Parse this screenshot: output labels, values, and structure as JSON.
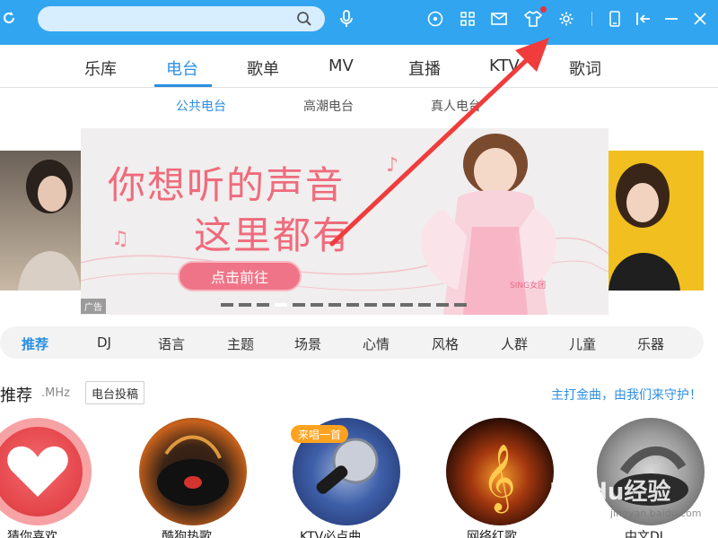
{
  "toolbar": {
    "search_placeholder": "",
    "icons": [
      "refresh-icon",
      "search-icon",
      "mic-icon",
      "disc-icon",
      "apps-grid-icon",
      "mail-icon",
      "skin-shirt-icon",
      "settings-gear-icon",
      "mobile-phone-icon",
      "mini-mode-icon",
      "minimize-icon",
      "close-icon"
    ],
    "accent": "#31a5f0"
  },
  "main_tabs": [
    {
      "label": "乐库",
      "active": false
    },
    {
      "label": "电台",
      "active": true
    },
    {
      "label": "歌单",
      "active": false
    },
    {
      "label": "MV",
      "active": false
    },
    {
      "label": "直播",
      "active": false
    },
    {
      "label": "KTV",
      "active": false
    },
    {
      "label": "歌词",
      "active": false
    }
  ],
  "sub_tabs": [
    {
      "label": "公共电台",
      "active": true
    },
    {
      "label": "高潮电台",
      "active": false
    },
    {
      "label": "真人电台",
      "active": false
    }
  ],
  "banner": {
    "line1": "你想听的声音",
    "line2": "这里都有",
    "button": "点击前往",
    "ad_tag": "广告",
    "brand": "SING女团",
    "slides_total": 14,
    "active_slide": 3
  },
  "categories": [
    {
      "label": "推荐",
      "active": true
    },
    {
      "label": "DJ",
      "active": false
    },
    {
      "label": "语言",
      "active": false
    },
    {
      "label": "主题",
      "active": false
    },
    {
      "label": "场景",
      "active": false
    },
    {
      "label": "心情",
      "active": false
    },
    {
      "label": "风格",
      "active": false
    },
    {
      "label": "人群",
      "active": false
    },
    {
      "label": "儿童",
      "active": false
    },
    {
      "label": "乐器",
      "active": false
    }
  ],
  "section": {
    "title": "推荐",
    "subtitle": ".MHz",
    "submit_button": "电台投稿",
    "right_link": "主打金曲，由我们来守护！"
  },
  "stations": [
    {
      "label": "猜你喜欢",
      "badge": ""
    },
    {
      "label": "酷狗热歌",
      "badge": ""
    },
    {
      "label": "KTV必点曲",
      "badge": "来唱一首"
    },
    {
      "label": "网络红歌",
      "badge": ""
    },
    {
      "label": "中文DJ",
      "badge": ""
    }
  ],
  "annotation_arrow_color": "#f03c3c",
  "watermark": {
    "text": "Baidu经验",
    "sub": "jingyan.baidu.com"
  }
}
